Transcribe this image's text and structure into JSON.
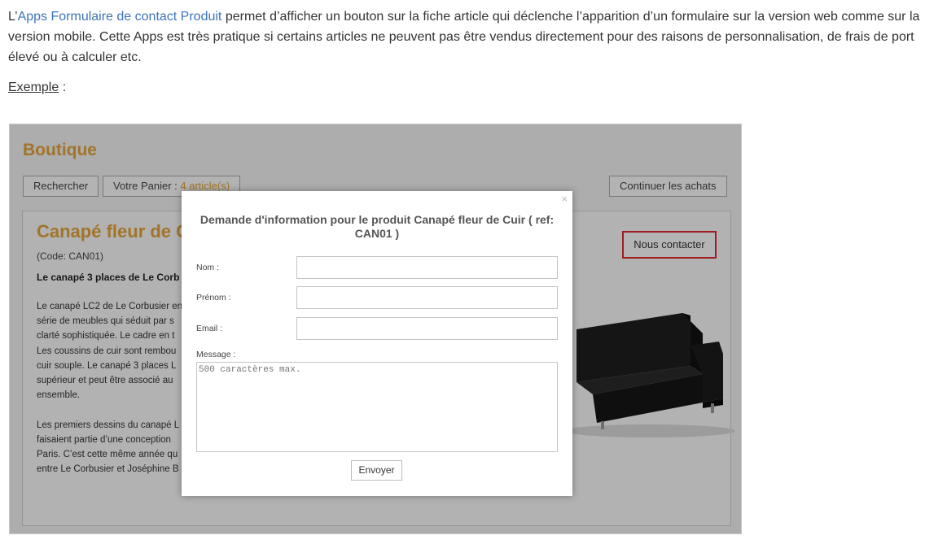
{
  "intro": {
    "prefix": "L’",
    "link": "Apps Formulaire de contact Produit",
    "rest": " permet d’afficher un bouton sur la fiche article qui déclenche l’apparition d’un formulaire sur la version web comme sur la version mobile. Cette Apps est très pratique si certains articles ne peuvent pas être vendus directement pour des raisons de personnalisation, de frais de port élevé ou à calculer etc."
  },
  "example": {
    "label": "Exemple",
    "suffix": " :"
  },
  "shop": {
    "title": "Boutique",
    "search_button": "Rechercher",
    "cart_label": "Votre Panier : ",
    "cart_count": "4 article(s)",
    "continue_button": "Continuer les achats"
  },
  "product": {
    "title": "Canapé fleur de C",
    "code": "(Code: CAN01)",
    "subtitle": "Le canapé 3 places de Le Corb",
    "description": "Le canapé LC2 de Le Corbusier en\nsérie de meubles qui séduit par s\nclarté sophistiquée. Le cadre en t\nLes coussins de cuir sont rembou\ncuir souple. Le canapé 3 places L\nsupérieur et peut être associé au\nensemble.\n\nLes premiers dessins du canapé L\nfaisaient partie d’une conception\nParis. C’est cette même année qu\nentre Le Corbusier et Joséphine B",
    "contact_button": "Nous contacter"
  },
  "modal": {
    "close": "×",
    "title": "Demande d'information pour le produit Canapé fleur de Cuir ( ref: CAN01 )",
    "fields": [
      {
        "label": "Nom :",
        "value": ""
      },
      {
        "label": "Prénom :",
        "value": ""
      },
      {
        "label": "Email :",
        "value": ""
      }
    ],
    "message_label": "Message :",
    "message_placeholder": "500 caractères max.",
    "send_button": "Envoyer"
  }
}
